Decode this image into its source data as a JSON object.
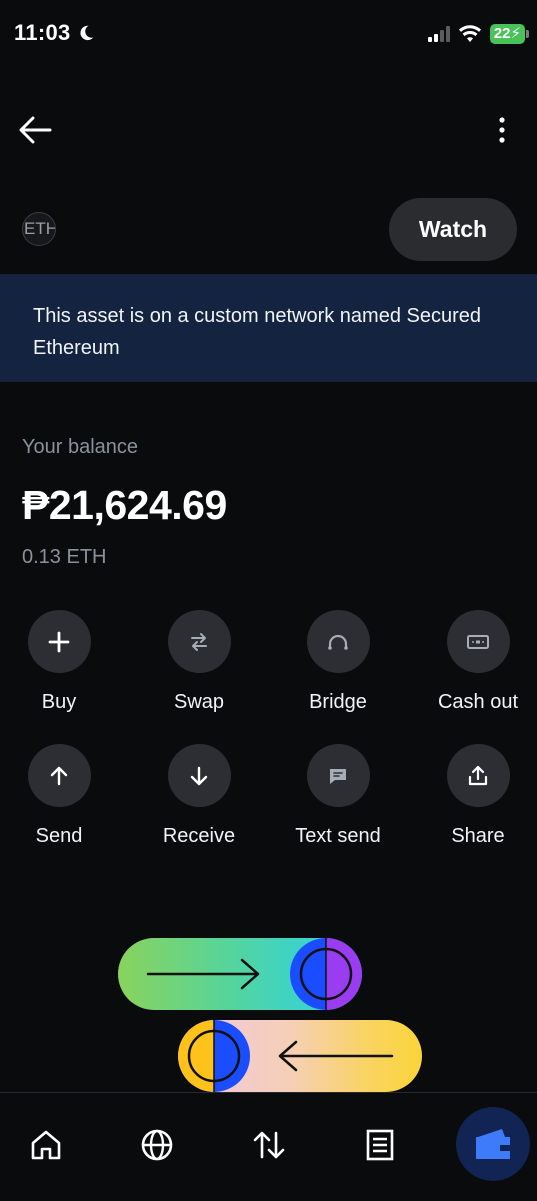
{
  "status_bar": {
    "time": "11:03",
    "battery": "22"
  },
  "asset": {
    "badge_text": "ETH",
    "watch_label": "Watch",
    "banner_text": "This asset is on a custom network named Secured Ethereum"
  },
  "balance": {
    "label": "Your balance",
    "value": "₱21,624.69",
    "crypto_amount": "0.13 ETH"
  },
  "actions": {
    "buy": "Buy",
    "swap": "Swap",
    "bridge": "Bridge",
    "cash_out": "Cash out",
    "send": "Send",
    "receive": "Receive",
    "text_send": "Text send",
    "share": "Share"
  },
  "bottom_nav": {
    "items": [
      "home-icon",
      "globe-icon",
      "transfer-icon",
      "list-icon",
      "wallet-icon"
    ],
    "active": "wallet-icon"
  },
  "colors": {
    "background": "#0a0b0d",
    "banner": "#132340",
    "button_bg": "#2c2e33",
    "muted_text": "#8a919e",
    "accent_blue": "#3e7bfa",
    "battery_green": "#4ac25a"
  }
}
